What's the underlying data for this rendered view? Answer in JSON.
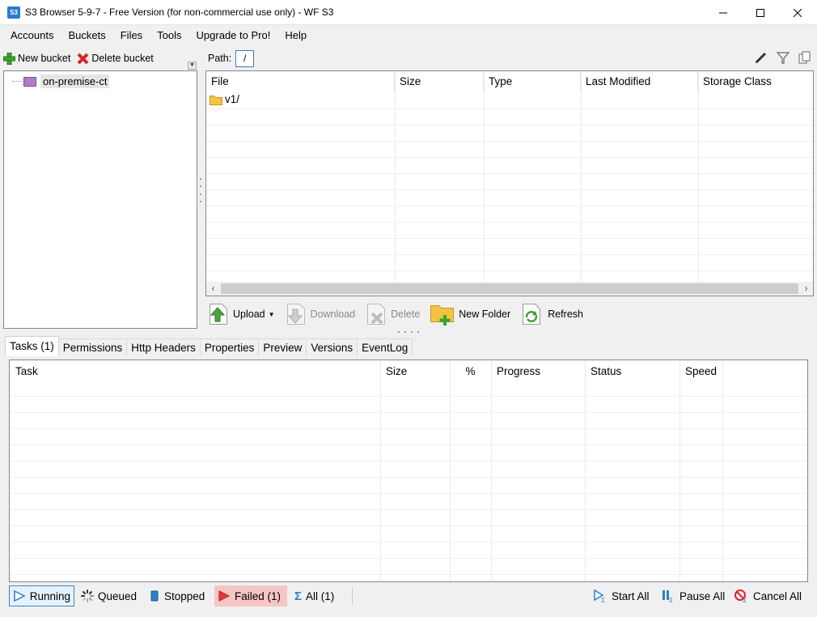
{
  "window": {
    "app_icon_text": "S3",
    "title": "S3 Browser 5-9-7 - Free Version (for non-commercial use only) - WF S3"
  },
  "menu": [
    "Accounts",
    "Buckets",
    "Files",
    "Tools",
    "Upgrade to Pro!",
    "Help"
  ],
  "left_toolbar": {
    "new_bucket": "New bucket",
    "delete_bucket": "Delete bucket"
  },
  "tree": {
    "nodes": [
      {
        "label": "on-premise-ct",
        "selected": true
      }
    ]
  },
  "path": {
    "label": "Path:",
    "value": "/"
  },
  "file_list": {
    "columns": [
      "File",
      "Size",
      "Type",
      "Last Modified",
      "Storage Class"
    ],
    "rows": [
      {
        "name": "v1/",
        "size": "",
        "type": "",
        "last_modified": "",
        "storage_class": "",
        "icon": "folder-icon"
      }
    ]
  },
  "actions": {
    "upload": "Upload",
    "download": "Download",
    "delete": "Delete",
    "new_folder": "New Folder",
    "refresh": "Refresh"
  },
  "tabs": [
    "Tasks (1)",
    "Permissions",
    "Http Headers",
    "Properties",
    "Preview",
    "Versions",
    "EventLog"
  ],
  "active_tab": "Tasks (1)",
  "task_grid": {
    "columns": [
      "Task",
      "Size",
      "%",
      "Progress",
      "Status",
      "Speed"
    ],
    "rows": []
  },
  "status_bar": {
    "running": "Running",
    "queued": "Queued",
    "stopped": "Stopped",
    "failed": "Failed (1)",
    "all": "All (1)",
    "start_all": "Start All",
    "pause_all": "Pause All",
    "cancel_all": "Cancel All"
  },
  "colors": {
    "accent": "#3d83c6",
    "failed_highlight": "#f7c5c5",
    "bucket": "#b07cc8",
    "folder": "#f5c342"
  }
}
